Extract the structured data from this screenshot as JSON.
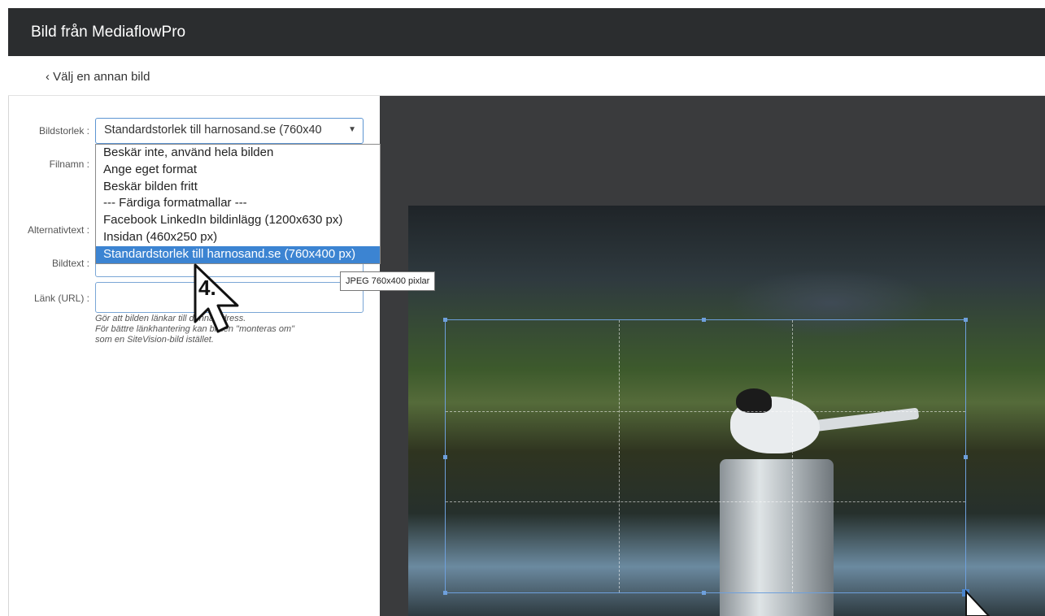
{
  "window": {
    "title": "Bild från MediaflowPro"
  },
  "nav": {
    "back_label": "‹  Välj en annan bild"
  },
  "form": {
    "size_label": "Bildstorlek :",
    "size_value": "Standardstorlek till harnosand.se (760x40",
    "filename_label": "Filnamn :",
    "alt_label": "Alternativtext :",
    "caption_label": "Bildtext :",
    "link_label": "Länk (URL) :",
    "link_value": "",
    "link_hint_1": "Gör att bilden länkar till denna adress.",
    "link_hint_2": "För bättre länkhantering kan bilden \"monteras om\"",
    "link_hint_3": "som en SiteVision-bild istället."
  },
  "dropdown": {
    "options": [
      "Beskär inte, använd hela bilden",
      "Ange eget format",
      "Beskär bilden fritt",
      "--- Färdiga formatmallar ---",
      "Facebook LinkedIn bildinlägg (1200x630 px)",
      "Insidan (460x250 px)",
      "Standardstorlek till harnosand.se (760x400 px)"
    ],
    "selected_index": 6
  },
  "tooltip": {
    "text": "JPEG 760x400 pixlar"
  },
  "annotation": {
    "step": "4."
  },
  "colors": {
    "accent": "#3c84d2",
    "titlebar": "#2b2d2f",
    "crop_border": "#6ea0dc"
  }
}
